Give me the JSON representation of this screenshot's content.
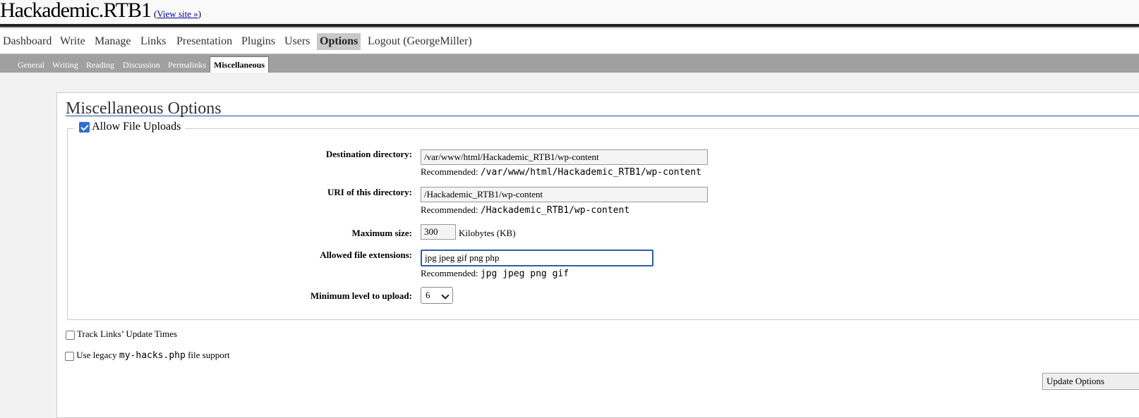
{
  "header": {
    "site_title": "Hackademic.RTB1",
    "view_site_open": "(",
    "view_site_link": "View site »",
    "view_site_close": ")"
  },
  "adminmenu": {
    "items": [
      {
        "label": "Dashboard"
      },
      {
        "label": "Write"
      },
      {
        "label": "Manage"
      },
      {
        "label": "Links"
      },
      {
        "label": "Presentation"
      },
      {
        "label": "Plugins"
      },
      {
        "label": "Users"
      },
      {
        "label": "Options",
        "current": true
      },
      {
        "label": "Logout (GeorgeMiller)"
      }
    ]
  },
  "submenu": {
    "items": [
      {
        "label": "General"
      },
      {
        "label": "Writing"
      },
      {
        "label": "Reading"
      },
      {
        "label": "Discussion"
      },
      {
        "label": "Permalinks"
      },
      {
        "label": "Miscellaneous",
        "current": true
      }
    ]
  },
  "page": {
    "title": "Miscellaneous Options"
  },
  "uploads": {
    "legend_label": "Allow File Uploads",
    "legend_checked": true,
    "destination": {
      "label": "Destination directory:",
      "value": "/var/www/html/Hackademic_RTB1/wp-content",
      "recommended_label": "Recommended:",
      "recommended_value": "/var/www/html/Hackademic_RTB1/wp-content"
    },
    "uri": {
      "label": "URI of this directory:",
      "value": "/Hackademic_RTB1/wp-content",
      "recommended_label": "Recommended:",
      "recommended_value": "/Hackademic_RTB1/wp-content"
    },
    "max_size": {
      "label": "Maximum size:",
      "value": "300",
      "unit": "Kilobytes (KB)"
    },
    "extensions": {
      "label": "Allowed file extensions:",
      "value": "jpg jpeg gif png php",
      "recommended_label": "Recommended:",
      "recommended_value": "jpg jpeg png gif"
    },
    "min_level": {
      "label": "Minimum level to upload:",
      "value": "6"
    }
  },
  "options": {
    "track_links_label": "Track Links’ Update Times",
    "track_links_checked": false,
    "legacy_prefix": "Use legacy",
    "legacy_code": "my-hacks.php",
    "legacy_suffix": "file support",
    "legacy_checked": false
  },
  "actions": {
    "update_button": "Update Options"
  },
  "colors": {
    "accent_blue": "#2f6cd6",
    "title_rule": "#0e5aa8",
    "submenu_bg": "#a0a0a0"
  }
}
